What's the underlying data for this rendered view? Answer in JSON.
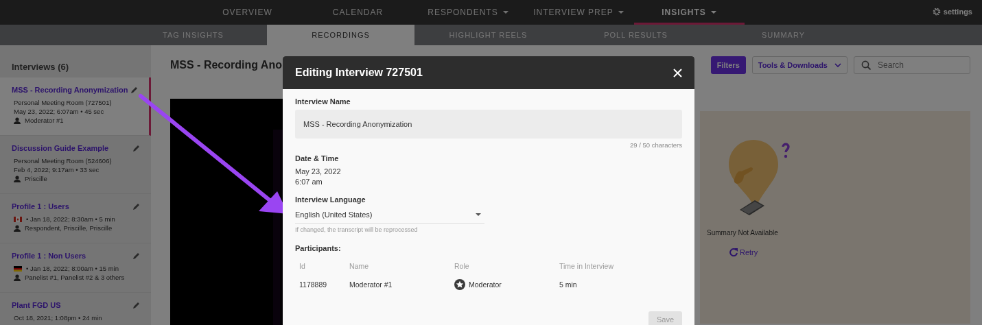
{
  "top_nav": {
    "items": [
      {
        "label": "OVERVIEW",
        "dropdown": false,
        "selected": false
      },
      {
        "label": "CALENDAR",
        "dropdown": false,
        "selected": false
      },
      {
        "label": "RESPONDENTS",
        "dropdown": true,
        "selected": false
      },
      {
        "label": "INTERVIEW PREP",
        "dropdown": true,
        "selected": false
      },
      {
        "label": "INSIGHTS",
        "dropdown": true,
        "selected": true
      }
    ],
    "settings": "settings"
  },
  "sub_nav": [
    {
      "label": "TAG INSIGHTS",
      "selected": false
    },
    {
      "label": "RECORDINGS",
      "selected": true
    },
    {
      "label": "HIGHLIGHT REELS",
      "selected": false
    },
    {
      "label": "POLL RESULTS",
      "selected": false
    },
    {
      "label": "SUMMARY",
      "selected": false
    }
  ],
  "sidebar": {
    "heading": "Interviews (6)",
    "items": [
      {
        "title": "MSS - Recording Anonymization",
        "selected": true,
        "details": [
          {
            "kind": "text",
            "text": "Personal Meeting Room (727501)"
          },
          {
            "kind": "text",
            "text": "May 23, 2022; 6:07am • 45 sec"
          },
          {
            "kind": "person",
            "text": "Moderator #1"
          }
        ]
      },
      {
        "title": "Discussion Guide Example",
        "selected": false,
        "details": [
          {
            "kind": "text",
            "text": "Personal Meeting Room (524606)"
          },
          {
            "kind": "text",
            "text": "Feb 4, 2022; 9:17am • 33 sec"
          },
          {
            "kind": "person",
            "text": "Priscille"
          }
        ]
      },
      {
        "title": "Profile 1 : Users",
        "selected": false,
        "details": [
          {
            "kind": "canada",
            "text": "• Jan 18, 2022; 8:30am • 5 min"
          },
          {
            "kind": "person",
            "text": "Respondent, Priscille, Priscille"
          }
        ]
      },
      {
        "title": "Profile 1 : Non Users",
        "selected": false,
        "details": [
          {
            "kind": "germany",
            "text": "• Jan 18, 2022; 8:00am • 15 min"
          },
          {
            "kind": "person",
            "text": "Panelist #1, Panelist #2 & 3 others"
          }
        ]
      },
      {
        "title": "Plant FGD US",
        "selected": false,
        "details": [
          {
            "kind": "text",
            "text": "Oct 18, 2021; 1:08pm • 24 min"
          }
        ]
      }
    ]
  },
  "main": {
    "title": "MSS - Recording Ano",
    "filters": "Filters",
    "tools": "Tools & Downloads",
    "search": {
      "placeholder": "Search"
    },
    "summary": {
      "message": "Summary Not Available",
      "retry": "Retry"
    }
  },
  "modal": {
    "title": "Editing Interview 727501",
    "name_label": "Interview Name",
    "name_value": "MSS - Recording Anonymization",
    "counter": "29 / 50 characters",
    "date_label": "Date & Time",
    "date": "May 23, 2022",
    "time": "6:07 am",
    "language_label": "Interview Language",
    "language": "English (United States)",
    "language_hint": "If changed, the transcript will be reprocessed",
    "participants_label": "Participants:",
    "columns": [
      "Id",
      "Name",
      "Role",
      "Time in Interview"
    ],
    "rows": [
      [
        "1178889",
        "Moderator #1",
        "Moderator",
        "5 min"
      ]
    ],
    "save": {
      "label": "Save",
      "disabled": true
    }
  }
}
